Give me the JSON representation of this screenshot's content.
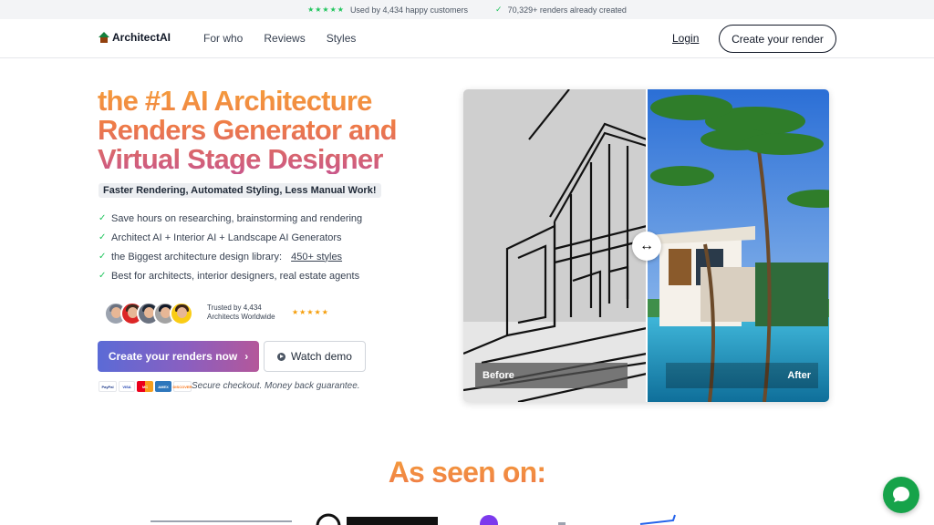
{
  "topbar": {
    "stars": "★★★★★",
    "customers_text": "Used by 4,434 happy customers",
    "check": "✓",
    "renders_text": "70,329+ renders already created"
  },
  "nav": {
    "logo_text": "ArchitectAI",
    "links": [
      "For who",
      "Reviews",
      "Styles"
    ],
    "login_label": "Login",
    "cta_label": "Create your render"
  },
  "hero": {
    "title_lines": [
      "the #1 AI Architecture",
      "Renders Generator and",
      "Virtual Stage Designer"
    ],
    "subtitle": "Faster Rendering, Automated Styling, Less Manual Work!",
    "bullets": [
      "Save hours on researching, brainstorming and rendering",
      "Architect AI + Interior AI + Landscape AI Generators",
      "the Biggest architecture design library:",
      "Best for architects, interior designers, real estate agents"
    ],
    "styles_link": "450+ styles",
    "trusted_line1": "Trusted by 4,434",
    "trusted_line2": "Architects Worldwide",
    "rating_stars": "★★★★★",
    "primary_button": "Create your renders now",
    "primary_chevron": "›",
    "secondary_button": "Watch demo",
    "payment_methods": [
      "PayPal",
      "VISA",
      "MC",
      "AMEX",
      "DISCOVER"
    ],
    "checkout_text": "Secure checkout. Money back guarantee."
  },
  "compare": {
    "before_label": "Before",
    "after_label": "After",
    "handle_glyph": "↔"
  },
  "seen_on": {
    "title": "As seen on:"
  },
  "colors": {
    "accent_green": "#22c55e",
    "gradient_orange": "#f59e3b",
    "gradient_pink": "#c9578a",
    "button_blue": "#5b6bd6",
    "button_magenta": "#b4579a",
    "chat_green": "#16a34a"
  }
}
